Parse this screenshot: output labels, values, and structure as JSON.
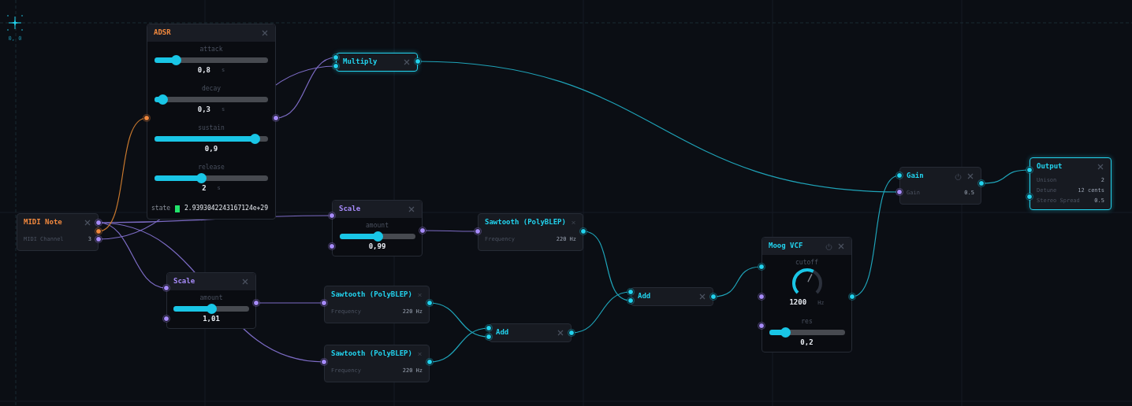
{
  "origin_label": "0, 0",
  "nodes": [
    {
      "kind": "envelope",
      "title": "ADSR",
      "color": "#f0883e",
      "selected": false,
      "controls": [
        {
          "kind": "slider",
          "label": "attack",
          "level": 0.19,
          "value": "0,8",
          "unit": "s"
        },
        {
          "kind": "slider",
          "label": "decay",
          "level": 0.07,
          "value": "0,3",
          "unit": "s"
        },
        {
          "kind": "slider",
          "label": "sustain",
          "level": 0.88,
          "value": "0,9"
        },
        {
          "kind": "slider",
          "label": "release",
          "level": 0.41,
          "value": "2",
          "unit": "s"
        },
        {
          "kind": "state",
          "label": "state",
          "value": "2.9393042243167124e+29"
        }
      ]
    },
    {
      "kind": "math",
      "title": "Multiply",
      "color": "#22d3ee",
      "selected": true
    },
    {
      "kind": "source",
      "title": "MIDI Note",
      "color": "#f0883e",
      "selected": false,
      "controls": [
        {
          "kind": "row",
          "label": "MIDI Channel",
          "value": "3"
        }
      ]
    },
    {
      "kind": "control",
      "title": "Scale",
      "color": "#a78bfa",
      "selected": false,
      "controls": [
        {
          "kind": "slider",
          "label": "amount",
          "level": 0.5,
          "value": "0,99"
        }
      ]
    },
    {
      "kind": "control",
      "title": "Scale",
      "color": "#a78bfa",
      "selected": false,
      "controls": [
        {
          "kind": "slider",
          "label": "amount",
          "level": 0.5,
          "value": "1,01"
        }
      ]
    },
    {
      "kind": "source",
      "title": "Sawtooth (PolyBLEP)",
      "color": "#22d3ee",
      "selected": false,
      "controls": [
        {
          "kind": "row",
          "label": "Frequency",
          "value": "220 Hz"
        }
      ]
    },
    {
      "kind": "source",
      "title": "Sawtooth (PolyBLEP)",
      "color": "#22d3ee",
      "selected": false,
      "controls": [
        {
          "kind": "row",
          "label": "Frequency",
          "value": "220 Hz"
        }
      ]
    },
    {
      "kind": "source",
      "title": "Sawtooth (PolyBLEP)",
      "color": "#22d3ee",
      "selected": false,
      "controls": [
        {
          "kind": "row",
          "label": "Frequency",
          "value": "220 Hz"
        }
      ]
    },
    {
      "kind": "math",
      "title": "Add",
      "color": "#22d3ee",
      "selected": false
    },
    {
      "kind": "math",
      "title": "Add",
      "color": "#22d3ee",
      "selected": false
    },
    {
      "kind": "control",
      "title": "Moog VCF",
      "color": "#22d3ee",
      "selected": false,
      "power_button": true,
      "controls": [
        {
          "kind": "knob",
          "label": "cutoff",
          "level": 0.6,
          "value": "1200",
          "unit": "Hz"
        },
        {
          "kind": "slider",
          "label": "res",
          "level": 0.21,
          "value": "0,2"
        }
      ]
    },
    {
      "kind": "source",
      "title": "Gain",
      "color": "#22d3ee",
      "selected": false,
      "power_button": true,
      "controls": [
        {
          "kind": "row",
          "label": "Gain",
          "value": "0.5"
        }
      ]
    },
    {
      "kind": "source",
      "title": "Output",
      "color": "#22d3ee",
      "selected": true,
      "controls": [
        {
          "kind": "row",
          "label": "Unison",
          "value": "2"
        },
        {
          "kind": "row",
          "label": "Detune",
          "value": "12 cents"
        },
        {
          "kind": "row",
          "label": "Stereo Spread",
          "value": "0.5"
        }
      ]
    }
  ]
}
